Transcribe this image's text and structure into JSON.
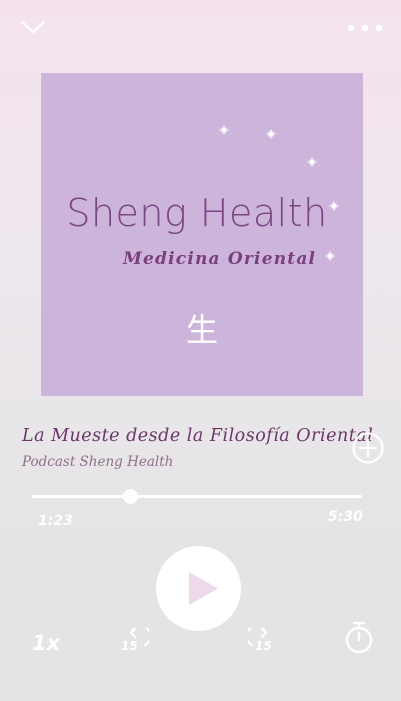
{
  "header": {
    "collapse_icon": "chevron-down-icon",
    "more_icon": "more-horizontal-icon"
  },
  "cover": {
    "title": "Sheng Health",
    "subtitle": "Medicina Oriental",
    "glyph": "生",
    "background": "#cdb4da",
    "title_color": "#7a4683"
  },
  "episode": {
    "title": "La Mueste desde la Filosofía Oriental",
    "podcast": "Podcast Sheng Health",
    "add_icon": "plus-circle-icon"
  },
  "progress": {
    "elapsed": "1:23",
    "total": "5:30",
    "fraction": 0.297
  },
  "controls": {
    "speed": "1x",
    "rewind_seconds": "15",
    "forward_seconds": "15",
    "play_icon": "play-icon",
    "timer_icon": "sleep-timer-icon"
  },
  "colors": {
    "accent": "#6b3769",
    "play_triangle": "#ecd9ea"
  }
}
